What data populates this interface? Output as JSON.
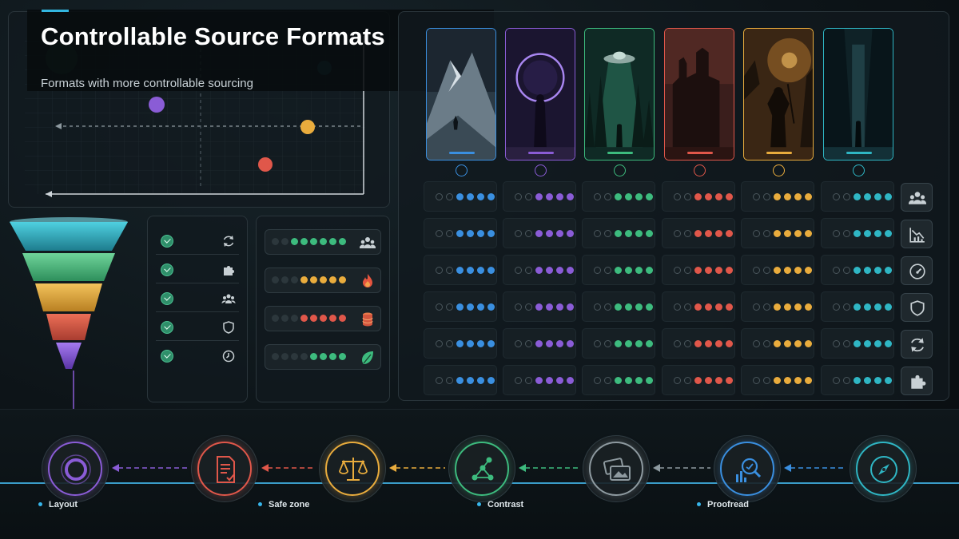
{
  "title": "Controllable Source Formats",
  "subtitle": "Formats with more controllable sourcing",
  "colors": {
    "blue": "#3a8fe0",
    "purple": "#8a5cd6",
    "green": "#3dbb7e",
    "red": "#e0574a",
    "yellow": "#e9ac3d",
    "teal": "#2fb6c4"
  },
  "scatter_points": [
    {
      "color": "#8a5cd6"
    },
    {
      "color": "#e9ac3d"
    },
    {
      "color": "#e0574a"
    },
    {
      "color": "#2fb6c4"
    }
  ],
  "funnel_levels": [
    "teal",
    "green",
    "yellow",
    "red",
    "purple"
  ],
  "checklist_icons": [
    "refresh-icon",
    "puzzle-icon",
    "users-icon",
    "shield-icon",
    "clock-icon"
  ],
  "meters": [
    {
      "icon": "users-icon",
      "color": "#3dbb7e",
      "filled": 6
    },
    {
      "icon": "fire-icon",
      "color": "#e9ac3d",
      "filled": 5
    },
    {
      "icon": "database-icon",
      "color": "#e0574a",
      "filled": 5
    },
    {
      "icon": "leaf-icon",
      "color": "#3dbb7e",
      "filled": 4
    }
  ],
  "cards": [
    {
      "scene": "mountain-climber",
      "color": "#3a8fe0"
    },
    {
      "scene": "portal-figure",
      "color": "#8a5cd6"
    },
    {
      "scene": "ufo-forest",
      "color": "#3dbb7e"
    },
    {
      "scene": "ruined-temple",
      "color": "#e0574a"
    },
    {
      "scene": "warrior-fire",
      "color": "#e9ac3d"
    },
    {
      "scene": "city-alley",
      "color": "#2fb6c4"
    }
  ],
  "side_icons": [
    "users-icon",
    "chart-down-icon",
    "gauge-icon",
    "shield-icon",
    "refresh-icon",
    "puzzle-icon"
  ],
  "timeline": {
    "nodes": [
      {
        "icon": "target-icon",
        "color": "#8a5cd6"
      },
      {
        "icon": "document-icon",
        "color": "#e0574a"
      },
      {
        "icon": "scales-icon",
        "color": "#e9ac3d"
      },
      {
        "icon": "network-icon",
        "color": "#3dbb7e"
      },
      {
        "icon": "images-icon",
        "color": "#8e9aa0"
      },
      {
        "icon": "search-chart-icon",
        "color": "#3a8fe0"
      },
      {
        "icon": "compass-icon",
        "color": "#2fb6c4"
      }
    ],
    "labels": [
      "Layout",
      "Safe zone",
      "Contrast",
      "Proofread"
    ]
  }
}
